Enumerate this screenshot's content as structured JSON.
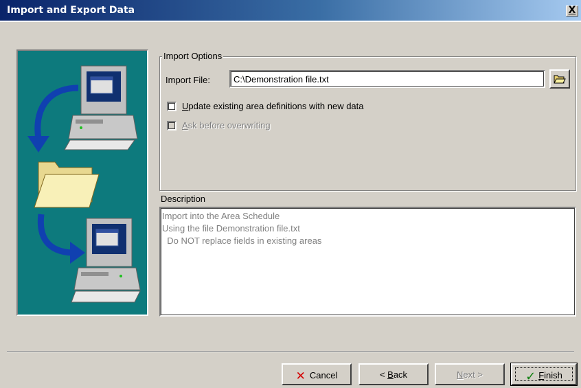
{
  "window": {
    "title": "Import and Export Data",
    "close_label": "X"
  },
  "import_options": {
    "legend": "Import Options",
    "import_file_label": "Import File:",
    "import_file_value": "C:\\Demonstration file.txt",
    "browse_icon": "folder-open-icon",
    "update_checkbox": {
      "label_prefix": "",
      "label_hotkey": "U",
      "label_rest": "pdate existing area definitions with new data",
      "checked": false,
      "enabled": true
    },
    "ask_checkbox": {
      "label_hotkey": "A",
      "label_rest": "sk before overwriting",
      "checked": false,
      "enabled": false
    }
  },
  "description": {
    "label": "Description",
    "lines": [
      "Import into the Area Schedule",
      "Using the file Demonstration file.txt",
      "  Do NOT replace fields in existing areas"
    ]
  },
  "buttons": {
    "cancel": {
      "label": "Cancel",
      "icon": "x-icon"
    },
    "back": {
      "label_prefix": "< ",
      "label_hotkey": "B",
      "label_rest": "ack"
    },
    "next": {
      "label_hotkey": "N",
      "label_rest": "ext >",
      "enabled": false
    },
    "finish": {
      "label_hotkey": "F",
      "label_rest": "inish",
      "icon": "checkmark-icon",
      "default": true
    }
  },
  "colors": {
    "title_bar_start": "#0a246a",
    "title_bar_end": "#a6caf0",
    "face": "#d4d0c8",
    "wizard_panel": "#0d7a7d"
  }
}
